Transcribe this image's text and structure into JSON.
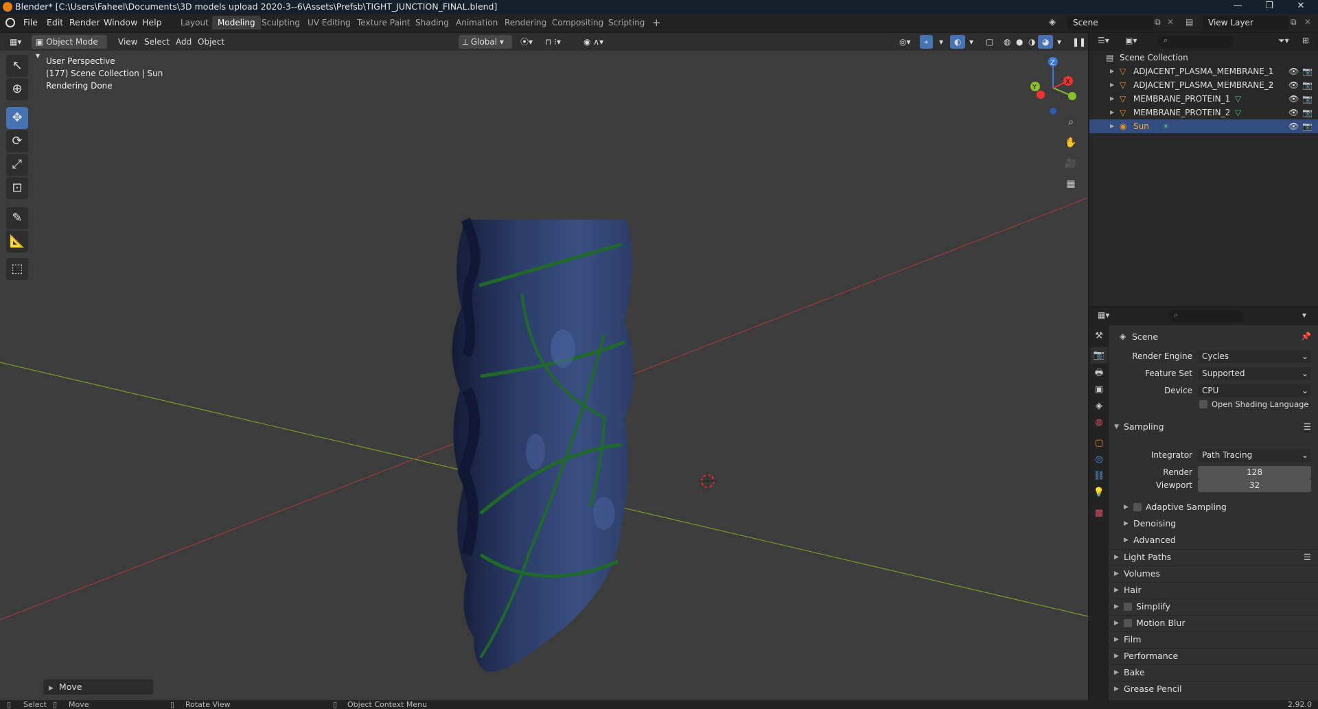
{
  "titlebar": {
    "title": "Blender* [C:\\Users\\Faheel\\Documents\\3D models upload 2020-3--6\\Assets\\Prefsb\\TIGHT_JUNCTION_FINAL.blend]",
    "minimize": "—",
    "maximize": "❐",
    "close": "✕"
  },
  "menubar": [
    "File",
    "Edit",
    "Render",
    "Window",
    "Help"
  ],
  "workspaces": [
    "Layout",
    "Modeling",
    "Sculpting",
    "UV Editing",
    "Texture Paint",
    "Shading",
    "Animation",
    "Rendering",
    "Compositing",
    "Scripting"
  ],
  "workspace_add": "+",
  "active_workspace": "Modeling",
  "scene": {
    "label": "Scene",
    "view_layer": "View Layer"
  },
  "viewport_header": {
    "mode": "Object Mode",
    "menus": [
      "View",
      "Select",
      "Add",
      "Object"
    ],
    "orientation": "Global"
  },
  "viewport_info": {
    "line1": "User Perspective",
    "line2": "(177) Scene Collection | Sun",
    "line3": "Rendering Done"
  },
  "gizmo": {
    "z": "Z",
    "y": "Y",
    "x": "X"
  },
  "last_operator": "Move",
  "outliner": {
    "root": "Scene Collection",
    "items": [
      {
        "name": "ADJACENT_PLASMA_MEMBRANE_1",
        "selected": false
      },
      {
        "name": "ADJACENT_PLASMA_MEMBRANE_2",
        "selected": false
      },
      {
        "name": "MEMBRANE_PROTEIN_1",
        "selected": false
      },
      {
        "name": "MEMBRANE_PROTEIN_2",
        "selected": false
      },
      {
        "name": "Sun",
        "selected": true
      }
    ]
  },
  "properties": {
    "context": "Scene",
    "render_engine_label": "Render Engine",
    "render_engine": "Cycles",
    "feature_set_label": "Feature Set",
    "feature_set": "Supported",
    "device_label": "Device",
    "device": "CPU",
    "osl_label": "Open Shading Language",
    "sampling": {
      "title": "Sampling",
      "integrator_label": "Integrator",
      "integrator": "Path Tracing",
      "render_label": "Render",
      "render": "128",
      "viewport_label": "Viewport",
      "viewport": "32",
      "subsections": [
        "Adaptive Sampling",
        "Denoising",
        "Advanced"
      ]
    },
    "panels": [
      "Light Paths",
      "Volumes",
      "Hair",
      "Simplify",
      "Motion Blur",
      "Film",
      "Performance",
      "Bake",
      "Grease Pencil"
    ]
  },
  "statusbar": {
    "select": "Select",
    "move": "Move",
    "rotate": "Rotate View",
    "context": "Object Context Menu",
    "version": "2.92.0"
  },
  "colors": {
    "accent": "#4772b3",
    "selected_row": "#334d80",
    "object_highlight": "#ffaf29",
    "mesh_blue": "#2a3a63",
    "protein_green": "#1f6a2a"
  }
}
